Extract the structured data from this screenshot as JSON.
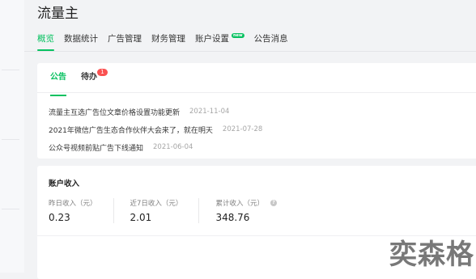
{
  "app": {
    "title": "流量主"
  },
  "nav": {
    "items": [
      {
        "label": "概览",
        "active": true
      },
      {
        "label": "数据统计"
      },
      {
        "label": "广告管理"
      },
      {
        "label": "财务管理"
      },
      {
        "label": "账户设置",
        "badge": "new"
      },
      {
        "label": "公告消息"
      }
    ]
  },
  "notice_card": {
    "tabs": [
      {
        "label": "公告"
      },
      {
        "label": "待办",
        "count": "1"
      }
    ],
    "notices": [
      {
        "title": "流量主互选广告位文章价格设置功能更新",
        "date": "2021-11-04"
      },
      {
        "title": "2021年微信广告生态合作伙伴大会来了，就在明天",
        "date": "2021-07-28"
      },
      {
        "title": "公众号视频前贴广告下线通知",
        "date": "2021-06-04"
      }
    ]
  },
  "income_card": {
    "title": "账户收入",
    "stats": [
      {
        "label": "昨日收入（元）",
        "value": "0.23"
      },
      {
        "label": "近7日收入（元）",
        "value": "2.01"
      },
      {
        "label": "累计收入（元）",
        "value": "348.76"
      }
    ]
  },
  "watermark": {
    "text": "奕森格"
  },
  "colors": {
    "accent": "#07c160",
    "badge_red": "#fa5151",
    "background": "#f2f3f5",
    "card": "#ffffff"
  }
}
